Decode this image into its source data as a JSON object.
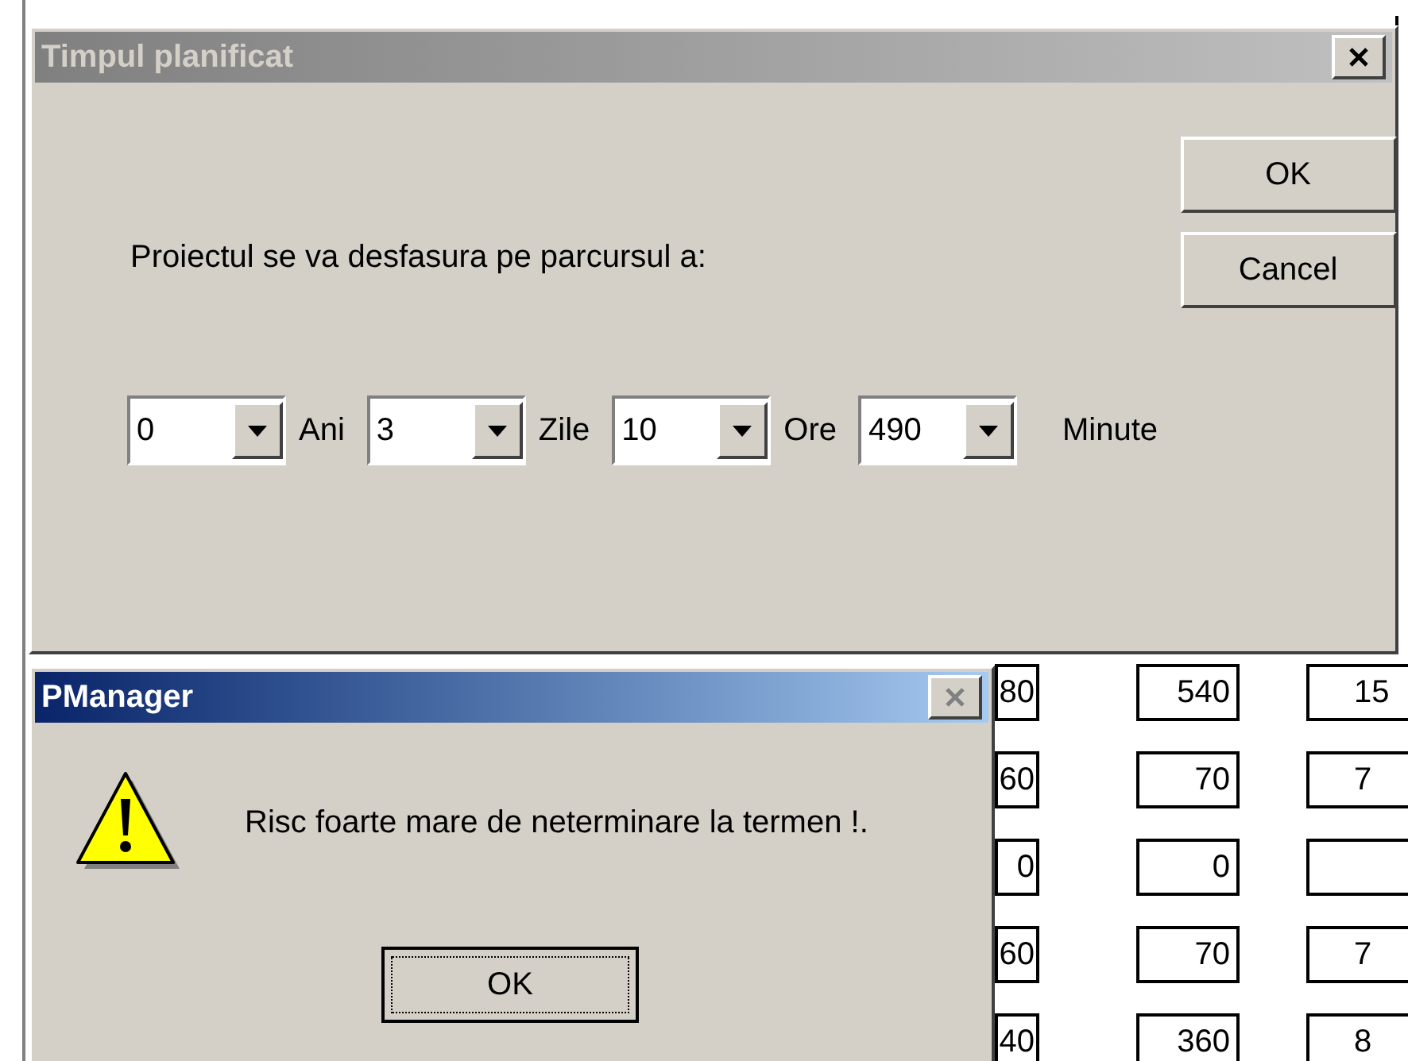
{
  "dialog": {
    "title": "Timpul planificat",
    "active": false,
    "prompt": "Proiectul se va desfasura pe parcursul a:",
    "buttons": [
      "OK",
      "Cancel"
    ],
    "durations": [
      {
        "value": "0",
        "unit": "Ani"
      },
      {
        "value": "3",
        "unit": "Zile"
      },
      {
        "value": "10",
        "unit": "Ore"
      },
      {
        "value": "490",
        "unit": "Minute"
      }
    ]
  },
  "message_box": {
    "title": "PManager",
    "active": true,
    "message": "Risc foarte mare de neterminare la termen !.",
    "button": "OK"
  },
  "background_table": {
    "rows": [
      {
        "column_1": "80",
        "column_2": "540",
        "column_3": "15"
      },
      {
        "column_1": "60",
        "column_2": "70",
        "column_3": "7"
      },
      {
        "column_1": "0",
        "column_2": "0"
      },
      {
        "column_1": "60",
        "column_2": "70",
        "column_3": "7"
      },
      {
        "column_1": "40",
        "column_2": "360",
        "column_3": "8"
      }
    ]
  }
}
